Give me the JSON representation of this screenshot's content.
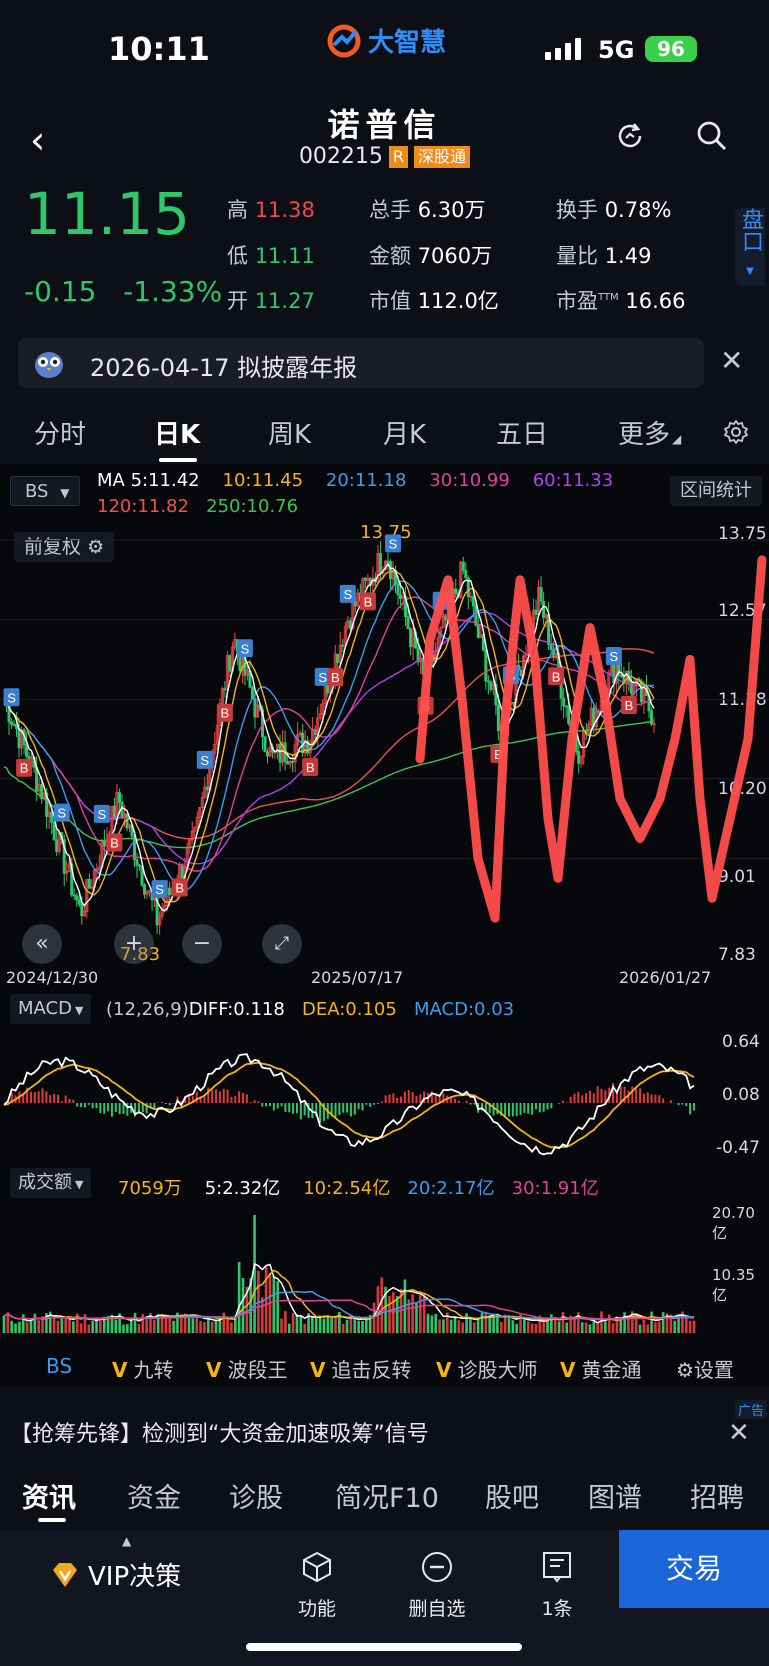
{
  "status_bar": {
    "time": "10:11",
    "app_name": "大智慧",
    "network": "5G",
    "battery": "96"
  },
  "header": {
    "stock_name": "诺普信",
    "stock_code": "002215",
    "tag_r": "R",
    "tag_exchange": "深股通"
  },
  "quote": {
    "price": "11.15",
    "change": "-0.15",
    "change_pct": "-1.33%",
    "high_label": "高",
    "high": "11.38",
    "low_label": "低",
    "low": "11.11",
    "open_label": "开",
    "open": "11.27",
    "total_hands_label": "总手",
    "total_hands": "6.30万",
    "amount_label": "金额",
    "amount": "7060万",
    "market_cap_label": "市值",
    "market_cap": "112.0亿",
    "turnover_label": "换手",
    "turnover": "0.78%",
    "vol_ratio_label": "量比",
    "vol_ratio": "1.49",
    "pe_label": "市盈",
    "pe_sup": "TTM",
    "pe": "16.66",
    "panel_tab": "盘口"
  },
  "notice": {
    "text": "2026-04-17 拟披露年报"
  },
  "tabs": [
    {
      "label": "分时"
    },
    {
      "label": "日K"
    },
    {
      "label": "周K"
    },
    {
      "label": "月K"
    },
    {
      "label": "五日"
    },
    {
      "label": "更多"
    }
  ],
  "kline": {
    "bs_selector": "BS",
    "range_stats": "区间统计",
    "adjust_label": "前复权",
    "ma": {
      "ma5": "MA 5:11.42",
      "ma10": "10:11.45",
      "ma20": "20:11.18",
      "ma30": "30:10.99",
      "ma60": "60:11.33",
      "ma120": "120:11.82",
      "ma250": "250:10.76"
    },
    "colors": {
      "ma5": "#ffffff",
      "ma10": "#f5b316",
      "ma20": "#3b9cf0",
      "ma30": "#e0409a",
      "ma60": "#b040f0",
      "ma120": "#f05050",
      "ma250": "#40c050",
      "up": "#f04848",
      "down": "#2ec76b"
    },
    "y_ticks": [
      "13.75",
      "12.57",
      "11.38",
      "10.20",
      "9.01",
      "7.83"
    ],
    "max_label": "13.75",
    "min_label": "7.83",
    "dates": [
      "2024/12/30",
      "2025/07/17",
      "2026/01/27"
    ]
  },
  "macd": {
    "selector": "MACD",
    "params": "(12,26,9)",
    "diff": "DIFF:0.118",
    "dea": "DEA:0.105",
    "macd": "MACD:0.03",
    "y_ticks": [
      "0.64",
      "0.08",
      "-0.47"
    ]
  },
  "volume": {
    "selector": "成交额",
    "current": "7059万",
    "ma5": "5:2.32亿",
    "ma10": "10:2.54亿",
    "ma20": "20:2.17亿",
    "ma30": "30:1.91亿",
    "y_ticks": [
      "20.70亿",
      "10.35亿"
    ]
  },
  "indicator_strip": {
    "items": [
      "BS",
      "九转",
      "波段王",
      "追击反转",
      "诊股大师",
      "黄金通"
    ],
    "vip_mark": "V",
    "settings": "设置"
  },
  "ad": {
    "text": "【抢筹先锋】检测到“大资金加速吸筹”信号",
    "tag": "广告"
  },
  "bottom_tabs": [
    {
      "label": "资讯"
    },
    {
      "label": "资金"
    },
    {
      "label": "诊股"
    },
    {
      "label": "简况F10"
    },
    {
      "label": "股吧"
    },
    {
      "label": "图谱"
    },
    {
      "label": "招聘"
    }
  ],
  "footer": {
    "vip": "VIP决策",
    "func": "功能",
    "remove": "删自选",
    "count": "1条",
    "trade": "交易"
  },
  "chart_data": {
    "type": "candlestick",
    "title": "",
    "x_range": [
      "2024/12/30",
      "2026/01/27"
    ],
    "ylim": [
      7.83,
      13.75
    ],
    "price_series": [
      {
        "date": "2024/12/30",
        "close": 11.4
      },
      {
        "date": "2025/02",
        "close": 10.0
      },
      {
        "date": "2025/03",
        "close": 8.2
      },
      {
        "date": "2025/04",
        "close": 9.9
      },
      {
        "date": "2025/04",
        "close": 8.1
      },
      {
        "date": "2025/05",
        "close": 9.3
      },
      {
        "date": "2025/06",
        "close": 12.3
      },
      {
        "date": "2025/06",
        "close": 10.5
      },
      {
        "date": "2025/07/17",
        "close": 10.8
      },
      {
        "date": "2025/08",
        "close": 12.6
      },
      {
        "date": "2025/09",
        "close": 13.6
      },
      {
        "date": "2025/10",
        "close": 11.6
      },
      {
        "date": "2025/10",
        "close": 13.3
      },
      {
        "date": "2025/11",
        "close": 10.9
      },
      {
        "date": "2025/12",
        "close": 12.9
      },
      {
        "date": "2026/01",
        "close": 10.6
      },
      {
        "date": "2026/01/27",
        "close": 11.9
      },
      {
        "date": "2026/02",
        "close": 11.15
      }
    ],
    "annotations": [
      "13.75",
      "7.83"
    ]
  }
}
